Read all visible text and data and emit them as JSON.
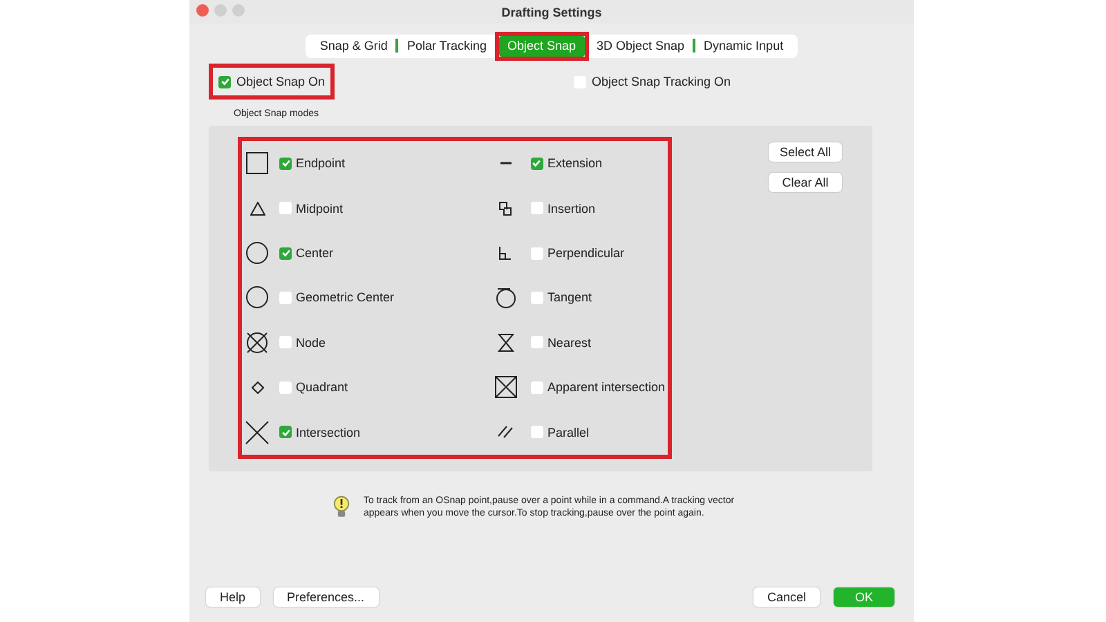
{
  "window": {
    "title": "Drafting Settings"
  },
  "tabs": [
    {
      "label": "Snap & Grid",
      "selected": false,
      "highlighted": false
    },
    {
      "label": "Polar Tracking",
      "selected": false,
      "highlighted": false
    },
    {
      "label": "Object Snap",
      "selected": true,
      "highlighted": true
    },
    {
      "label": "3D Object Snap",
      "selected": false,
      "highlighted": false
    },
    {
      "label": "Dynamic Input",
      "selected": false,
      "highlighted": false
    }
  ],
  "toggles": [
    {
      "label": "Object Snap On",
      "checked": true,
      "highlighted": true
    },
    {
      "label": "Object Snap Tracking On",
      "checked": false,
      "highlighted": false
    }
  ],
  "modes_section": {
    "title": "Object Snap modes",
    "highlighted": true,
    "columns": [
      [
        {
          "label": "Endpoint",
          "checked": true
        },
        {
          "label": "Midpoint",
          "checked": false
        },
        {
          "label": "Center",
          "checked": true
        },
        {
          "label": "Geometric Center",
          "checked": false
        },
        {
          "label": "Node",
          "checked": false
        },
        {
          "label": "Quadrant",
          "checked": false
        },
        {
          "label": "Intersection",
          "checked": true
        }
      ],
      [
        {
          "label": "Extension",
          "checked": true
        },
        {
          "label": "Insertion",
          "checked": false
        },
        {
          "label": "Perpendicular",
          "checked": false
        },
        {
          "label": "Tangent",
          "checked": false
        },
        {
          "label": "Nearest",
          "checked": false
        },
        {
          "label": "Apparent intersection",
          "checked": false
        },
        {
          "label": "Parallel",
          "checked": false
        }
      ]
    ],
    "side_buttons": [
      "Select All",
      "Clear All"
    ]
  },
  "tip": "To track from an OSnap point,pause over a point while in a command.A tracking vector appears when you move the cursor.To stop tracking,pause over the point again.",
  "footer": {
    "left_buttons": [
      "Help",
      "Preferences..."
    ],
    "cancel": "Cancel",
    "ok": "OK"
  }
}
